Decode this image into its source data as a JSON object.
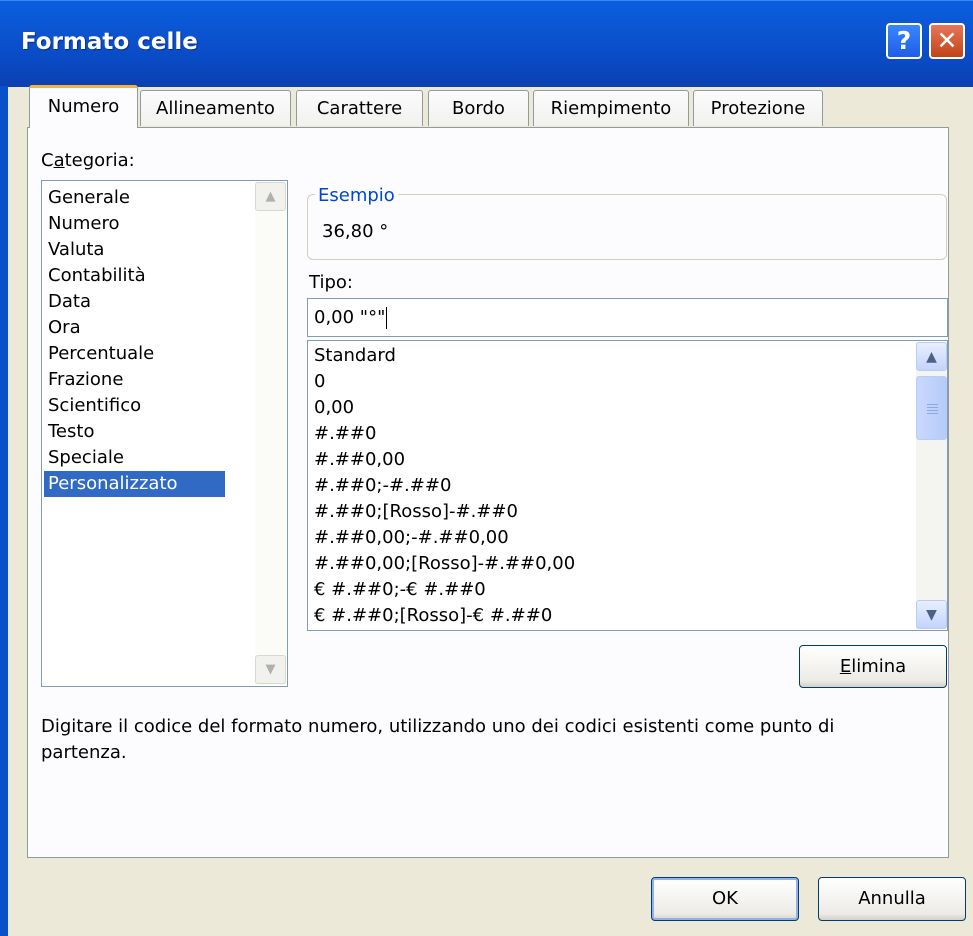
{
  "window": {
    "title": "Formato celle"
  },
  "titlebar": {
    "help_glyph": "?",
    "close_glyph": "✕"
  },
  "tabs": [
    {
      "label": "Numero",
      "active": true
    },
    {
      "label": "Allineamento",
      "active": false
    },
    {
      "label": "Carattere",
      "active": false
    },
    {
      "label": "Bordo",
      "active": false
    },
    {
      "label": "Riempimento",
      "active": false
    },
    {
      "label": "Protezione",
      "active": false
    }
  ],
  "category": {
    "label_pre": "C",
    "label_ul": "a",
    "label_post": "tegoria:",
    "items": [
      "Generale",
      "Numero",
      "Valuta",
      "Contabilità",
      "Data",
      "Ora",
      "Percentuale",
      "Frazione",
      "Scientifico",
      "Testo",
      "Speciale",
      "Personalizzato"
    ],
    "selected": "Personalizzato"
  },
  "sample": {
    "label": "Esempio",
    "value": "36,80 °"
  },
  "type": {
    "label": "Tipo:",
    "value": "0,00 \"°\"",
    "items": [
      "Standard",
      "0",
      "0,00",
      "#.##0",
      "#.##0,00",
      "#.##0;-#.##0",
      "#.##0;[Rosso]-#.##0",
      "#.##0,00;-#.##0,00",
      "#.##0,00;[Rosso]-#.##0,00",
      "€ #.##0;-€ #.##0",
      "€ #.##0;[Rosso]-€ #.##0"
    ]
  },
  "buttons": {
    "delete_ul": "E",
    "delete_rest": "limina",
    "ok": "OK",
    "cancel": "Annulla"
  },
  "description": "Digitare il codice del formato numero, utilizzando uno dei codici esistenti come punto di partenza.",
  "icons": {
    "up": "▲",
    "down": "▼"
  },
  "colors": {
    "title_bar": "#0a5fe0",
    "selection": "#316ac5",
    "group_label": "#0046d5",
    "active_tab": "#f6b33b"
  }
}
